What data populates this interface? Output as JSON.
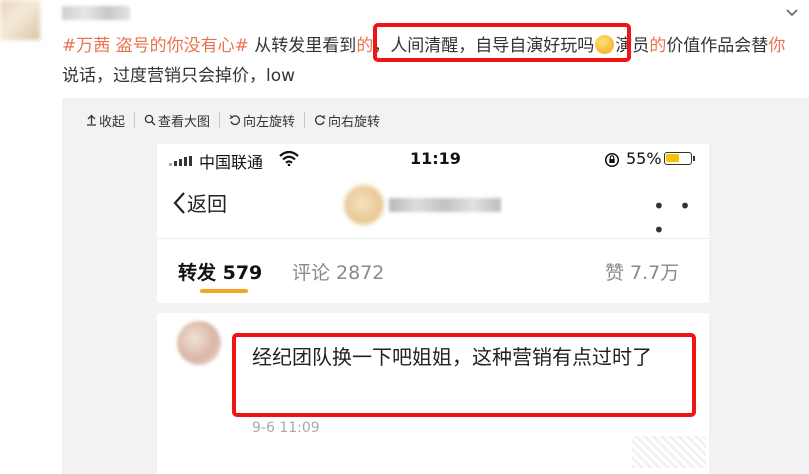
{
  "post": {
    "text_parts": {
      "tag": "#万茜 盗号的你没有心#",
      "t1": " 从转发里看到",
      "t2": "的",
      "t3": "，",
      "t4": "人间清醒，自导自演好玩吗",
      "t5": "演员",
      "t6": "的",
      "t7": "价值作品会替",
      "t8": "你",
      "t9": "说话，过度营销只会掉价，low"
    }
  },
  "toolbar": {
    "collapse_label": "收起",
    "view_large_label": "查看大图",
    "rotate_left_label": "向左旋转",
    "rotate_right_label": "向右旋转"
  },
  "phone": {
    "status": {
      "carrier": "中国联通",
      "time": "11:19",
      "battery_pct": "55%",
      "battery_level": 0.55,
      "accent": "#f5c400"
    },
    "nav": {
      "back_label": "返回",
      "more_label": "• • •"
    },
    "tabs": {
      "repost": "转发 579",
      "comment": "评论 2872",
      "like": "赞 7.7万",
      "underline_color": "#f5a623"
    },
    "comment": {
      "text": "经纪团队换一下吧姐姐，这种营销有点过时了",
      "time": "9-6 11:09"
    }
  },
  "colors": {
    "highlight_box": "#f01414",
    "tag": "#eb7350"
  }
}
